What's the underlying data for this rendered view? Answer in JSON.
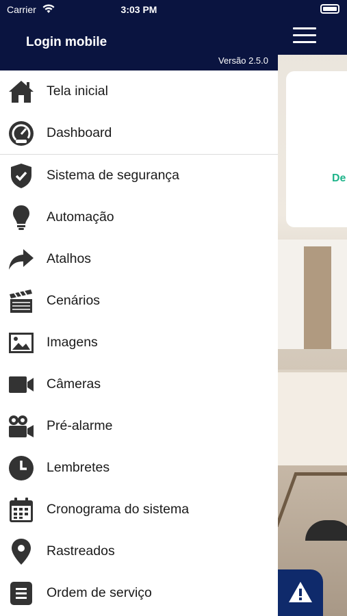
{
  "status_bar": {
    "carrier": "Carrier",
    "time": "3:03 PM"
  },
  "drawer": {
    "title": "Login mobile",
    "version": "Versão 2.5.0",
    "items": [
      {
        "label": "Tela inicial",
        "icon": "home-icon"
      },
      {
        "label": "Dashboard",
        "icon": "gauge-icon"
      },
      {
        "label": "Sistema de segurança",
        "icon": "shield-icon"
      },
      {
        "label": "Automação",
        "icon": "lightbulb-icon"
      },
      {
        "label": "Atalhos",
        "icon": "share-arrow-icon"
      },
      {
        "label": "Cenários",
        "icon": "clapperboard-icon"
      },
      {
        "label": "Imagens",
        "icon": "image-icon"
      },
      {
        "label": "Câmeras",
        "icon": "video-camera-icon"
      },
      {
        "label": "Pré-alarme",
        "icon": "film-camera-icon"
      },
      {
        "label": "Lembretes",
        "icon": "clock-icon"
      },
      {
        "label": "Cronograma do sistema",
        "icon": "calendar-icon"
      },
      {
        "label": "Rastreados",
        "icon": "map-pin-icon"
      },
      {
        "label": "Ordem de serviço",
        "icon": "document-list-icon"
      }
    ]
  },
  "background": {
    "card_text": "De"
  },
  "colors": {
    "header": "#0a1440",
    "accent": "#1fb48a",
    "icon": "#333333"
  }
}
